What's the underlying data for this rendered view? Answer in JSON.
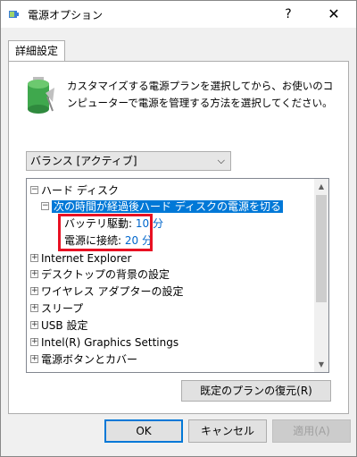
{
  "window": {
    "title": "電源オプション",
    "help": "?",
    "close": "✕"
  },
  "tab": {
    "label": "詳細設定"
  },
  "description": "カスタマイズする電源プランを選択してから、お使いのコンピューターで電源を管理する方法を選択してください。",
  "plan_select": {
    "value": "バランス [アクティブ]"
  },
  "tree": {
    "items": [
      {
        "label": "ハード ディスク",
        "expander": "⊟"
      },
      {
        "label": "次の時間が経過後ハード ディスクの電源を切る",
        "expander": "⊟",
        "selected": true
      },
      {
        "label": "バッテリ駆動:",
        "value": "10 分"
      },
      {
        "label": "電源に接続:",
        "value": "20 分"
      },
      {
        "label": "Internet Explorer",
        "expander": "⊞"
      },
      {
        "label": "デスクトップの背景の設定",
        "expander": "⊞"
      },
      {
        "label": "ワイヤレス アダプターの設定",
        "expander": "⊞"
      },
      {
        "label": "スリープ",
        "expander": "⊞"
      },
      {
        "label": "USB 設定",
        "expander": "⊞"
      },
      {
        "label": "Intel(R) Graphics Settings",
        "expander": "⊞"
      },
      {
        "label": "電源ボタンとカバー",
        "expander": "⊞"
      }
    ]
  },
  "buttons": {
    "restore": "既定のプランの復元(R)",
    "ok": "OK",
    "cancel": "キャンセル",
    "apply": "適用(A)"
  },
  "colors": {
    "selection": "#0078d7",
    "value_link": "#0066cc",
    "highlight_box": "#e81123"
  }
}
